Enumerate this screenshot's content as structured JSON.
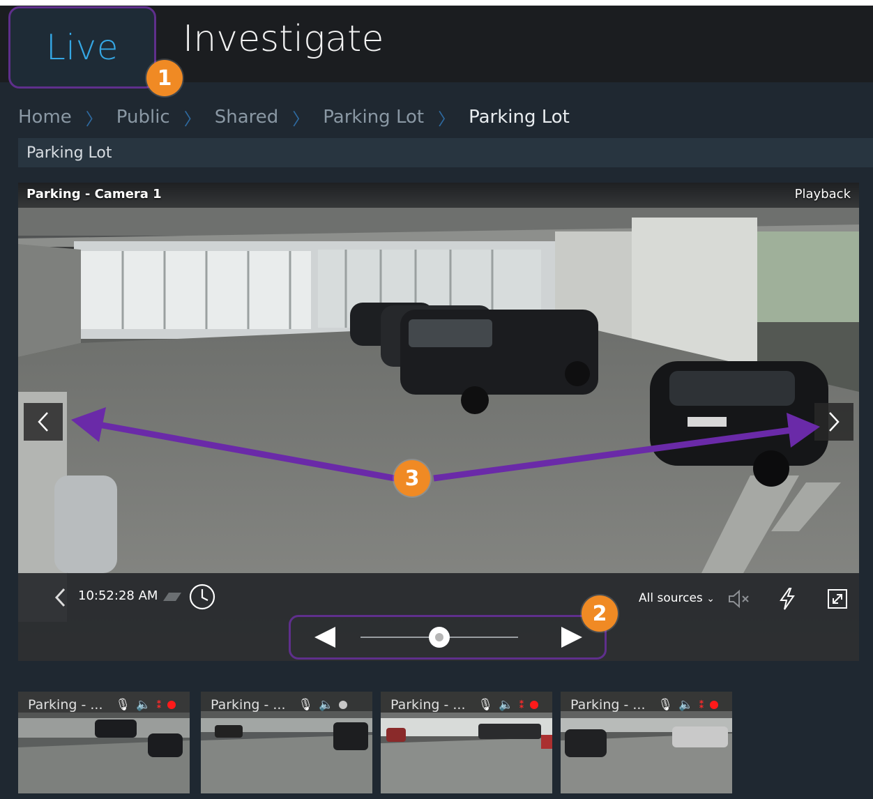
{
  "header": {
    "tabs": [
      {
        "label": "Live",
        "active": true
      },
      {
        "label": "Investigate",
        "active": false
      }
    ]
  },
  "callouts": [
    "1",
    "2",
    "3"
  ],
  "breadcrumb": [
    "Home",
    "Public",
    "Shared",
    "Parking Lot",
    "Parking Lot"
  ],
  "view_title": "Parking Lot",
  "player": {
    "camera_name": "Parking - Camera 1",
    "mode_label": "Playback",
    "timestamp": "10:52:28 AM",
    "sources_label": "All sources",
    "timeline_position": 0.5
  },
  "thumbnails": [
    {
      "label": "Parking - ...",
      "recording": true,
      "selected": true
    },
    {
      "label": "Parking - ...",
      "recording": false,
      "selected": false
    },
    {
      "label": "Parking - ...",
      "recording": true,
      "selected": false
    },
    {
      "label": "Parking - ...",
      "recording": true,
      "selected": false
    }
  ],
  "colors": {
    "accent_blue": "#35a7e4",
    "callout_orange": "#f08a24",
    "highlight_purple": "#5f2f8c",
    "annotation_purple": "#6a2aa8",
    "selected_outline": "#2f89d9",
    "record_red": "#ff1a1a"
  },
  "icons": {
    "prev_camera": "chevron-left-icon",
    "next_camera": "chevron-right-icon",
    "clock": "clock-icon",
    "mute": "speaker-muted-icon",
    "trigger": "lightning-icon",
    "fullscreen": "expand-icon",
    "mic": "microphone-icon",
    "speaker": "speaker-icon"
  }
}
